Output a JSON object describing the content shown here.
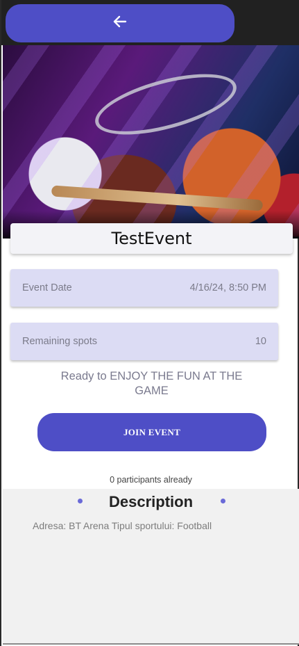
{
  "event": {
    "title": "TestEvent",
    "date_label": "Event Date",
    "date_value": "4/16/24, 8:50 PM",
    "spots_label": "Remaining spots",
    "spots_value": "10",
    "tagline": "Ready to ENJOY THE FUN AT THE GAME",
    "join_label": "JOIN EVENT",
    "participants": "0 participants already"
  },
  "description": {
    "heading": "Description",
    "text": "Adresa: BT Arena Tipul sportului: Football"
  },
  "icons": {
    "back": "arrow-left-icon"
  },
  "colors": {
    "accent": "#4e4ec6",
    "card": "#dcdcf4",
    "topbar": "#212121"
  }
}
